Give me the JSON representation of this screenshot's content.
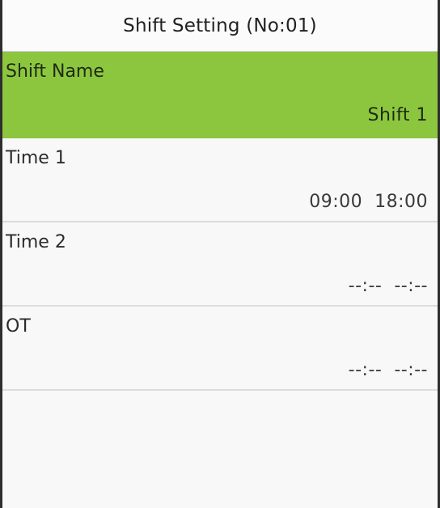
{
  "header": {
    "title": "Shift Setting (No:01)"
  },
  "items": [
    {
      "label": "Shift Name",
      "value": "Shift 1"
    },
    {
      "label": "Time 1",
      "value": "09:00  18:00"
    },
    {
      "label": "Time 2",
      "value": "--:--  --:--"
    },
    {
      "label": "OT",
      "value": "--:--  --:--"
    }
  ],
  "colors": {
    "selected_background": "#8cc63f",
    "divider": "#dcdcdc",
    "screen_background": "#f8f8f8"
  }
}
